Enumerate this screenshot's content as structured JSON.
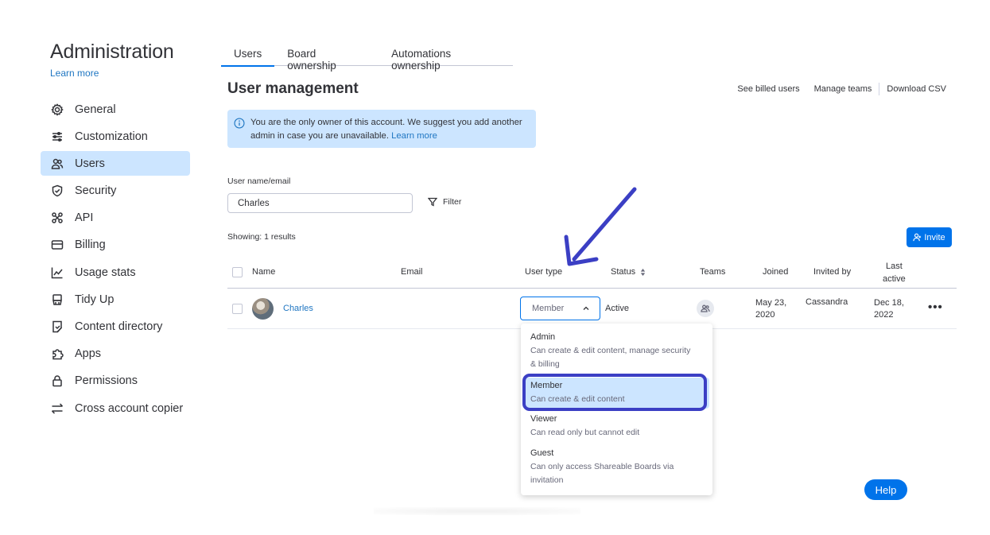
{
  "sidebar": {
    "title": "Administration",
    "learn_more": "Learn more",
    "items": [
      {
        "label": "General",
        "icon": "gear-icon"
      },
      {
        "label": "Customization",
        "icon": "sliders-icon"
      },
      {
        "label": "Users",
        "icon": "users-icon",
        "active": true
      },
      {
        "label": "Security",
        "icon": "shield-icon"
      },
      {
        "label": "API",
        "icon": "api-icon"
      },
      {
        "label": "Billing",
        "icon": "card-icon"
      },
      {
        "label": "Usage stats",
        "icon": "chart-icon"
      },
      {
        "label": "Tidy Up",
        "icon": "broom-icon"
      },
      {
        "label": "Content directory",
        "icon": "document-icon"
      },
      {
        "label": "Apps",
        "icon": "puzzle-icon"
      },
      {
        "label": "Permissions",
        "icon": "lock-icon"
      },
      {
        "label": "Cross account copier",
        "icon": "swap-icon"
      }
    ]
  },
  "tabs": [
    {
      "label": "Users",
      "active": true
    },
    {
      "label": "Board ownership"
    },
    {
      "label": "Automations ownership"
    }
  ],
  "header": {
    "title": "User management",
    "links": [
      "See billed users",
      "Manage teams",
      "Download CSV"
    ]
  },
  "notice": {
    "text": "You are the only owner of this account. We suggest you add another admin in case you are unavailable.",
    "link": "Learn more"
  },
  "search": {
    "label": "User name/email",
    "value": "Charles",
    "filter_label": "Filter"
  },
  "results_text": "Showing: 1 results",
  "invite_label": "Invite",
  "table": {
    "headers": {
      "name": "Name",
      "email": "Email",
      "user_type": "User type",
      "status": "Status",
      "teams": "Teams",
      "joined": "Joined",
      "invited_by": "Invited by",
      "last_active_1": "Last",
      "last_active_2": "active"
    },
    "row": {
      "name": "Charles",
      "email": "",
      "user_type": "Member",
      "status": "Active",
      "joined_1": "May 23,",
      "joined_2": "2020",
      "invited_by": "Cassandra",
      "last_active_1": "Dec 18,",
      "last_active_2": "2022",
      "more": "•••"
    }
  },
  "dropdown": {
    "options": [
      {
        "title": "Admin",
        "desc_1": "Can create & edit content, manage security",
        "desc_2": "& billing"
      },
      {
        "title": "Member",
        "desc_1": "Can create & edit content",
        "selected": true
      },
      {
        "title": "Viewer",
        "desc_1": "Can read only but cannot edit"
      },
      {
        "title": "Guest",
        "desc_1": "Can only access Shareable Boards via",
        "desc_2": "invitation"
      }
    ]
  },
  "help_label": "Help",
  "colors": {
    "primary": "#0073ea",
    "selected_bg": "#cce5ff",
    "link": "#1f76c2",
    "annotation": "#3b3fc4",
    "text": "#323338"
  }
}
